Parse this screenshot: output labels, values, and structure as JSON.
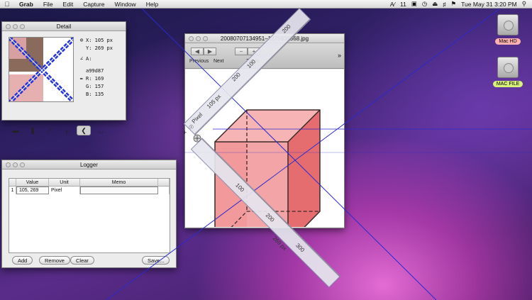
{
  "menubar": {
    "apple_icon": "apple-icon",
    "app_name": "Grab",
    "items": [
      "File",
      "Edit",
      "Capture",
      "Window",
      "Help"
    ],
    "status": {
      "adobe": "11",
      "datetime": "Tue May 31  3:20 PM"
    }
  },
  "desktop": {
    "disks": [
      {
        "label": "Mac HD",
        "label_color": "#ffb0b0"
      },
      {
        "label": "MAC FILE",
        "label_color": "#d6f07a"
      }
    ]
  },
  "detail": {
    "title": "Detail",
    "x": "X: 105 px",
    "y": "Y: 269 px",
    "a": "A:",
    "hex": "a99d87",
    "r": "R: 169",
    "g": "G: 157",
    "b": "B: 135"
  },
  "logger": {
    "title": "Logger",
    "columns": [
      "Value",
      "Unit",
      "Memo"
    ],
    "rows": [
      {
        "index": "1",
        "value": "105, 269",
        "unit": "Pixel",
        "memo": ""
      }
    ],
    "buttons": {
      "add": "Add",
      "remove": "Remove",
      "clear": "Clear",
      "save": "Save..."
    }
  },
  "image_window": {
    "title": "20080707134951–1275939568.jpg",
    "toolbar": {
      "previous": "Previous",
      "next": "Next",
      "zoom": "Zoom"
    }
  },
  "ruler": {
    "top_labels": [
      "200",
      "100"
    ],
    "side_labels": [
      "105 px",
      "Pixel"
    ],
    "bottom_labels": [
      "100",
      "200",
      "300",
      "269 px"
    ],
    "measure_label": "200"
  },
  "colors": {
    "guide_line": "#2a2acc",
    "cube_fill": "#f08a8a",
    "ruler_fill": "#e6e6ee"
  }
}
